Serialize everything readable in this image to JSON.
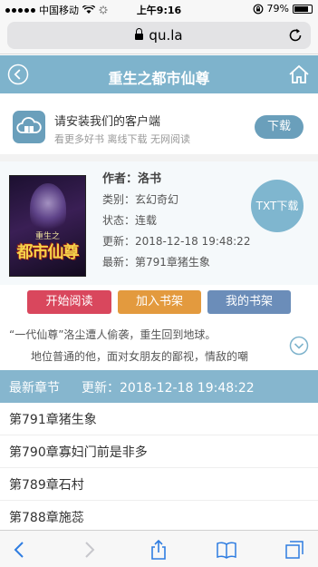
{
  "status_bar": {
    "carrier": "中国移动",
    "time": "上午9:16",
    "battery": "79%"
  },
  "browser": {
    "url": "qu.la"
  },
  "header": {
    "title": "重生之都市仙尊"
  },
  "install_banner": {
    "title": "请安装我们的客户端",
    "subtitle": "看更多好书 离线下载 无网阅读",
    "download_label": "下载"
  },
  "book": {
    "cover_subtitle": "重生之",
    "cover_title": "都市仙尊",
    "author": "作者：洛书",
    "category": "类别：玄幻奇幻",
    "status": "状态：连载",
    "updated": "更新：2018-12-18 19:48:22",
    "latest": "最新：第791章猪生象",
    "txt_download_label": "TXT下载"
  },
  "actions": {
    "start_reading": "开始阅读",
    "add_to_shelf": "加入书架",
    "my_shelf": "我的书架"
  },
  "intro": {
    "line1": "“一代仙尊”洛尘遭人偷袭，重生回到地球。",
    "line2": "地位普通的他，面对女朋友的鄙视，情敌的嘲"
  },
  "latest_section": {
    "label": "最新章节",
    "update": "更新：2018-12-18 19:48:22"
  },
  "chapters": [
    "第791章猪生象",
    "第790章寡妇门前是非多",
    "第789章石村",
    "第788章施蕊"
  ],
  "colors": {
    "header": "#7eb3cc",
    "accent": "#6a9fbb",
    "read_button": "#d9475d",
    "shelf_button": "#e39a3e",
    "my_shelf_button": "#6b8db9"
  }
}
